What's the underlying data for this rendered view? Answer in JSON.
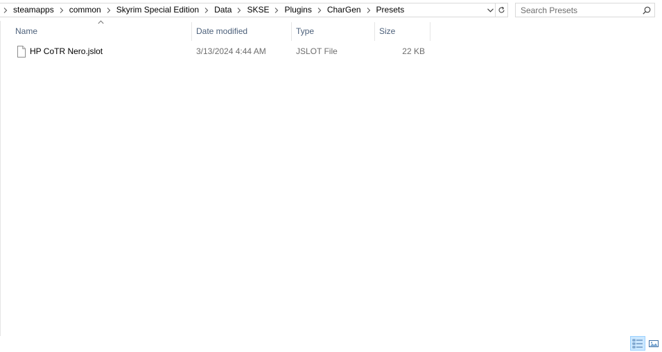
{
  "address_bar": {
    "breadcrumbs": [
      "steamapps",
      "common",
      "Skyrim Special Edition",
      "Data",
      "SKSE",
      "Plugins",
      "CharGen",
      "Presets"
    ]
  },
  "search": {
    "placeholder": "Search Presets",
    "value": ""
  },
  "columns": [
    {
      "label": "Name",
      "sorted": "ascending"
    },
    {
      "label": "Date modified"
    },
    {
      "label": "Type"
    },
    {
      "label": "Size"
    }
  ],
  "files": [
    {
      "name": "HP CoTR Nero.jslot",
      "date_modified": "3/13/2024 4:44 AM",
      "type": "JSLOT File",
      "size": "22 KB",
      "icon": "generic-file-icon"
    }
  ],
  "status_bar": {
    "active_view": "details",
    "views": [
      "details-view-icon",
      "large-icons-view-icon"
    ]
  },
  "colors": {
    "header_text": "#4c607a",
    "meta_text": "#6d6d6d",
    "selected_view_bg": "#cce8ff",
    "selected_view_border": "#99d1ff"
  }
}
